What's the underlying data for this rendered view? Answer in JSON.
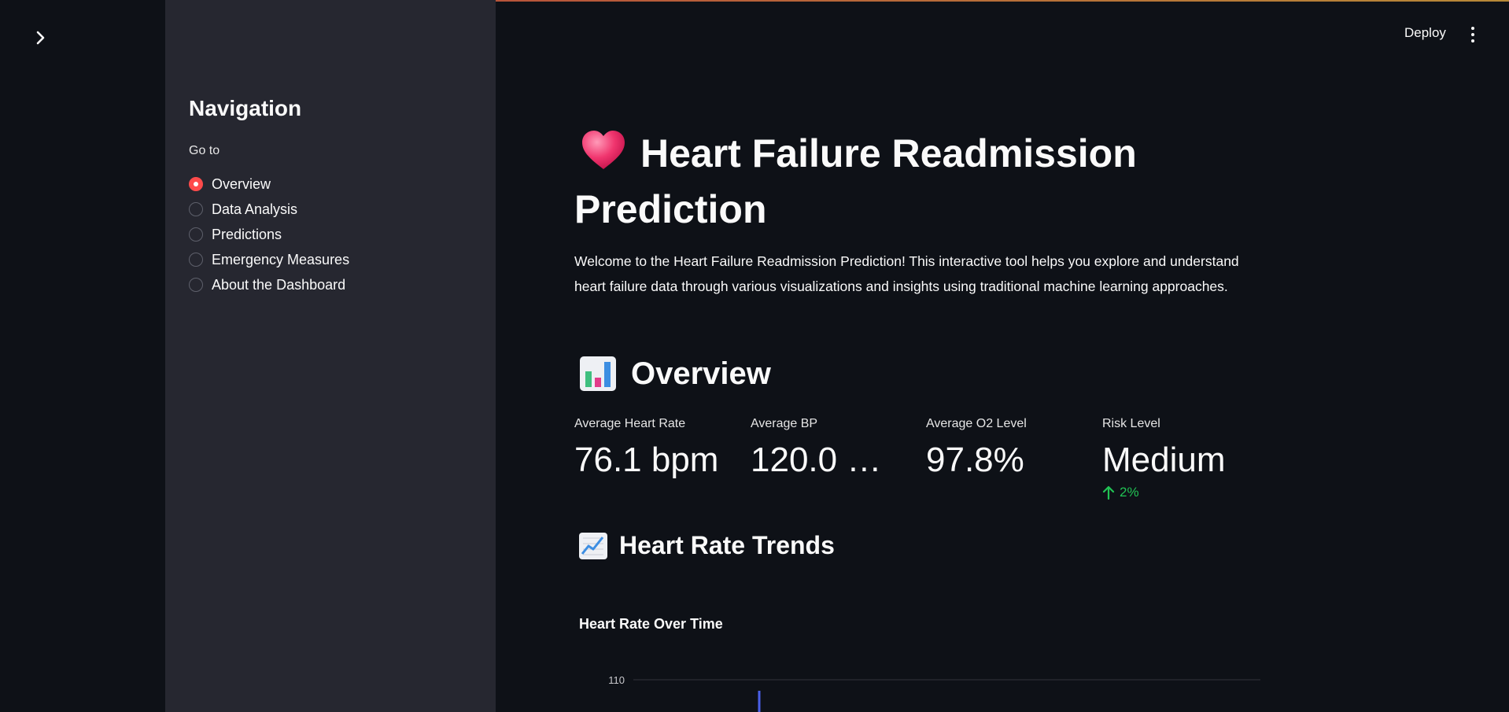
{
  "colors": {
    "background": "#0e1117",
    "sidebar": "#262730",
    "accent": "#ff4b4b",
    "delta_positive": "#21c354",
    "chart_line": "#4a60e8"
  },
  "header": {
    "deploy_label": "Deploy",
    "menu_icon": "kebab-icon",
    "expand_icon": "chevron-right-icon"
  },
  "sidebar": {
    "title": "Navigation",
    "radio_label": "Go to",
    "options": [
      {
        "label": "Overview",
        "selected": true
      },
      {
        "label": "Data Analysis",
        "selected": false
      },
      {
        "label": "Predictions",
        "selected": false
      },
      {
        "label": "Emergency Measures",
        "selected": false
      },
      {
        "label": "About the Dashboard",
        "selected": false
      }
    ]
  },
  "main": {
    "title": "Heart Failure Readmission Prediction",
    "title_icon": "heart-icon",
    "intro": "Welcome to the Heart Failure Readmission Prediction! This interactive tool helps you explore and understand heart failure data through various visualizations and insights using traditional machine learning approaches.",
    "overview_heading": "Overview",
    "overview_icon": "bar-chart-icon",
    "metrics": [
      {
        "label": "Average Heart Rate",
        "value": "76.1 bpm"
      },
      {
        "label": "Average BP",
        "value": "120.0 m…"
      },
      {
        "label": "Average O2 Level",
        "value": "97.8%"
      },
      {
        "label": "Risk Level",
        "value": "Medium",
        "delta": "2%"
      }
    ],
    "trends_heading": "Heart Rate Trends",
    "trends_icon": "line-chart-icon"
  },
  "chart_data": {
    "type": "line",
    "title": "Heart Rate Over Time",
    "y_ticks_visible": [
      110
    ],
    "series": [
      {
        "values": []
      }
    ]
  }
}
